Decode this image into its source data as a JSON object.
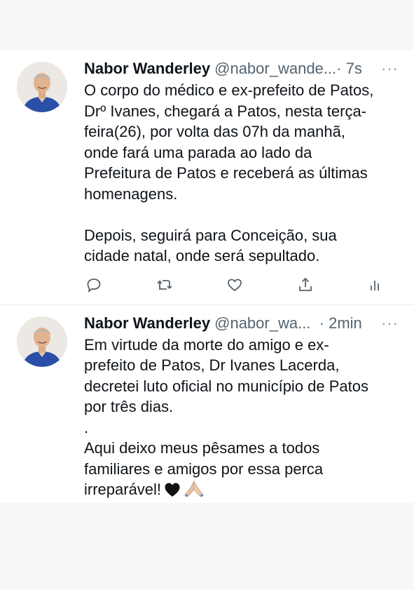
{
  "tweets": [
    {
      "name": "Nabor Wanderley",
      "handle": "@nabor_wande...",
      "time": " · 7s",
      "more": "···",
      "text": "O corpo do médico e ex-prefeito de Patos,\nDrº Ivanes, chegará a Patos, nesta terça-\nfeira(26), por volta das 07h da manhã,\nonde fará uma parada ao lado da\nPrefeitura de Patos e receberá as últimas\nhomenagens.\n\nDepois, seguirá para Conceição, sua\ncidade natal, onde será sepultado.",
      "icons": [
        "reply-icon",
        "retweet-icon",
        "like-icon",
        "share-icon",
        "analytics-icon"
      ]
    },
    {
      "name": "Nabor Wanderley",
      "handle": "@nabor_wa...",
      "time": "  · 2min",
      "more": "···",
      "text": "Em virtude da morte do amigo e ex-\nprefeito de Patos, Dr Ivanes Lacerda,\ndecretei luto oficial no município de Patos\npor três dias.\n.\nAqui deixo meus pêsames a todos\nfamiliares e amigos por essa perca\nirreparável!",
      "emojis": [
        "black-heart-icon",
        "folded-hands-icon"
      ]
    }
  ],
  "colors": {
    "text": "#0f1419",
    "secondary": "#536471",
    "background": "#f7f7f7",
    "card": "#ffffff",
    "avatar_shirt": "#2b4fa8"
  }
}
